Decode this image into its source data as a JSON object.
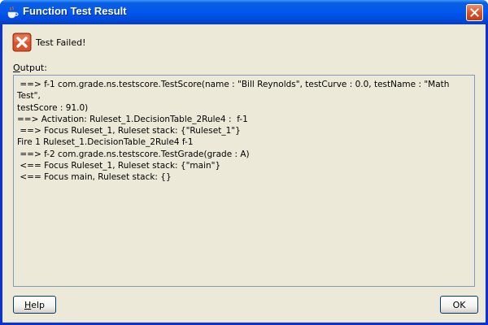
{
  "window": {
    "title": "Function Test Result",
    "icons": {
      "title": "java-cup-icon",
      "close": "close-icon",
      "status": "error-x-icon"
    }
  },
  "status": {
    "text": "Test Failed!"
  },
  "output": {
    "label_mnemonic": "O",
    "label_rest": "utput:",
    "text": " ==> f-1 com.grade.ns.testscore.TestScore(name : \"Bill Reynolds\", testCurve : 0.0, testName : \"Math Test\",\ntestScore : 91.0)\n==> Activation: Ruleset_1.DecisionTable_2Rule4 :  f-1\n ==> Focus Ruleset_1, Ruleset stack: {\"Ruleset_1\"}\nFire 1 Ruleset_1.DecisionTable_2Rule4 f-1\n ==> f-2 com.grade.ns.testscore.TestGrade(grade : A)\n <== Focus Ruleset_1, Ruleset stack: {\"main\"}\n <== Focus main, Ruleset stack: {}"
  },
  "buttons": {
    "help_mnemonic": "H",
    "help_rest": "elp",
    "ok": "OK"
  },
  "colors": {
    "titlebar": "#0058ee",
    "dialog_bg": "#ece9d8",
    "close_button": "#d8542c",
    "error_icon": "#d9532b"
  }
}
